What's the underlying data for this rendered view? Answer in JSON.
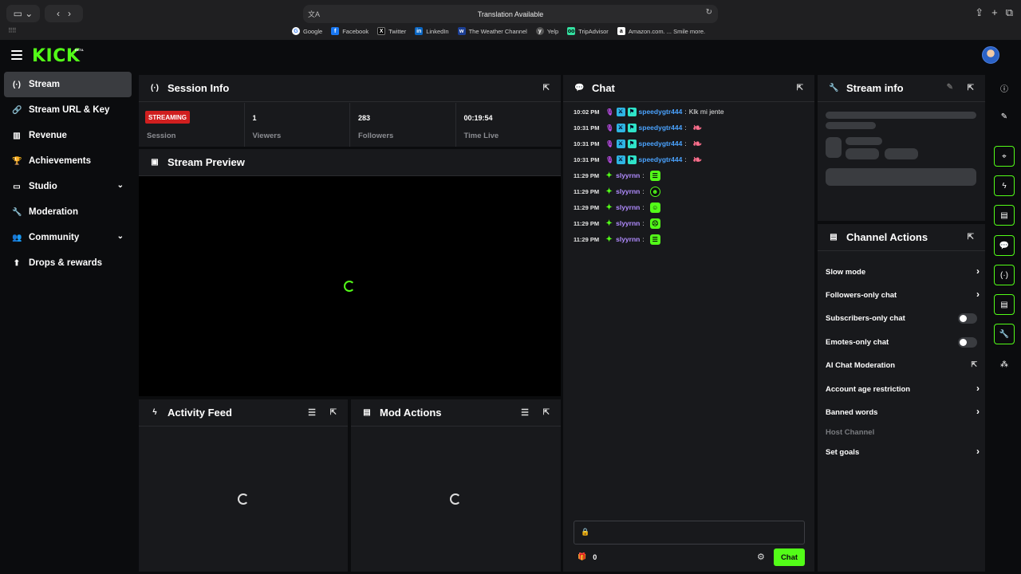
{
  "browser": {
    "address_text": "Translation Available",
    "bookmarks": [
      "Google",
      "Facebook",
      "Twitter",
      "LinkedIn",
      "The Weather Channel",
      "Yelp",
      "TripAdvisor",
      "Amazon.com. ... Smile more."
    ]
  },
  "header": {
    "logo": "KICK",
    "logo_badge": "BETA"
  },
  "sidebar": {
    "items": [
      {
        "label": "Stream",
        "icon": "broadcast-icon",
        "glyph": "(·)"
      },
      {
        "label": "Stream URL & Key",
        "icon": "link-icon",
        "glyph": "🔗"
      },
      {
        "label": "Revenue",
        "icon": "chart-icon",
        "glyph": "▥"
      },
      {
        "label": "Achievements",
        "icon": "trophy-icon",
        "glyph": "🏆"
      },
      {
        "label": "Studio",
        "icon": "studio-icon",
        "glyph": "▭"
      },
      {
        "label": "Moderation",
        "icon": "wrench-icon",
        "glyph": "🔧"
      },
      {
        "label": "Community",
        "icon": "community-icon",
        "glyph": "👥"
      },
      {
        "label": "Drops & rewards",
        "icon": "drops-icon",
        "glyph": "⬆"
      }
    ]
  },
  "session": {
    "title": "Session Info",
    "status_badge": "STREAMING",
    "cells": [
      {
        "value": "",
        "label": "Session"
      },
      {
        "value": "1",
        "label": "Viewers"
      },
      {
        "value": "283",
        "label": "Followers"
      },
      {
        "value": "00:19:54",
        "label": "Time Live"
      }
    ]
  },
  "preview": {
    "title": "Stream Preview"
  },
  "activity": {
    "title": "Activity Feed"
  },
  "mod_actions": {
    "title": "Mod Actions"
  },
  "chat": {
    "title": "Chat",
    "messages": [
      {
        "time": "10:02 PM",
        "user": "speedygtr444",
        "sep": ":",
        "text": "Klk mi jente"
      },
      {
        "time": "10:31 PM",
        "user": "speedygtr444",
        "sep": ":",
        "text": ""
      },
      {
        "time": "10:31 PM",
        "user": "speedygtr444",
        "sep": ":",
        "text": ""
      },
      {
        "time": "10:31 PM",
        "user": "speedygtr444",
        "sep": ":",
        "text": ""
      },
      {
        "time": "11:29 PM",
        "user": "slyyrnn",
        "sep": ":",
        "text": ""
      },
      {
        "time": "11:29 PM",
        "user": "slyyrnn",
        "sep": ":",
        "text": ""
      },
      {
        "time": "11:29 PM",
        "user": "slyyrnn",
        "sep": ":",
        "text": ""
      },
      {
        "time": "11:29 PM",
        "user": "slyyrnn",
        "sep": ":",
        "text": ""
      },
      {
        "time": "11:29 PM",
        "user": "slyyrnn",
        "sep": ":",
        "text": ""
      }
    ],
    "footer_count": "0",
    "send_label": "Chat"
  },
  "stream_info": {
    "title": "Stream info"
  },
  "channel_actions": {
    "title": "Channel Actions",
    "items": [
      {
        "label": "Slow mode",
        "kind": "chevron"
      },
      {
        "label": "Followers-only chat",
        "kind": "chevron"
      },
      {
        "label": "Subscribers-only chat",
        "kind": "toggle"
      },
      {
        "label": "Emotes-only chat",
        "kind": "toggle"
      },
      {
        "label": "AI Chat Moderation",
        "kind": "external"
      },
      {
        "label": "Account age restriction",
        "kind": "chevron"
      },
      {
        "label": "Banned words",
        "kind": "chevron"
      },
      {
        "label": "Host Channel",
        "kind": "disabled"
      },
      {
        "label": "Set goals",
        "kind": "chevron"
      }
    ]
  },
  "colors": {
    "accent": "#53fc18",
    "live": "#d01f1f",
    "panel": "#18191c",
    "background": "#0b0c0e"
  }
}
